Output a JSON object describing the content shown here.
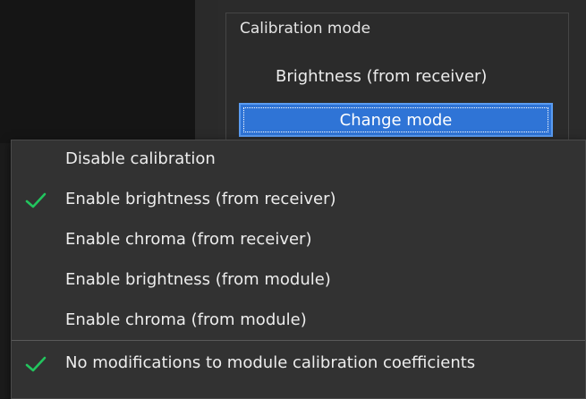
{
  "panel": {
    "group_title": "Calibration mode",
    "current_mode": "Brightness (from receiver)",
    "change_button": "Change mode"
  },
  "menu": {
    "items": [
      {
        "label": "Disable calibration",
        "checked": false
      },
      {
        "label": "Enable brightness (from receiver)",
        "checked": true
      },
      {
        "label": "Enable chroma (from receiver)",
        "checked": false
      },
      {
        "label": "Enable brightness (from module)",
        "checked": false
      },
      {
        "label": "Enable chroma (from module)",
        "checked": false
      }
    ],
    "footer_item": {
      "label": "No modifications to module calibration coefficients",
      "checked": true
    }
  },
  "colors": {
    "accent": "#2f74d6",
    "check": "#22c55e",
    "menu_bg": "#323232"
  }
}
